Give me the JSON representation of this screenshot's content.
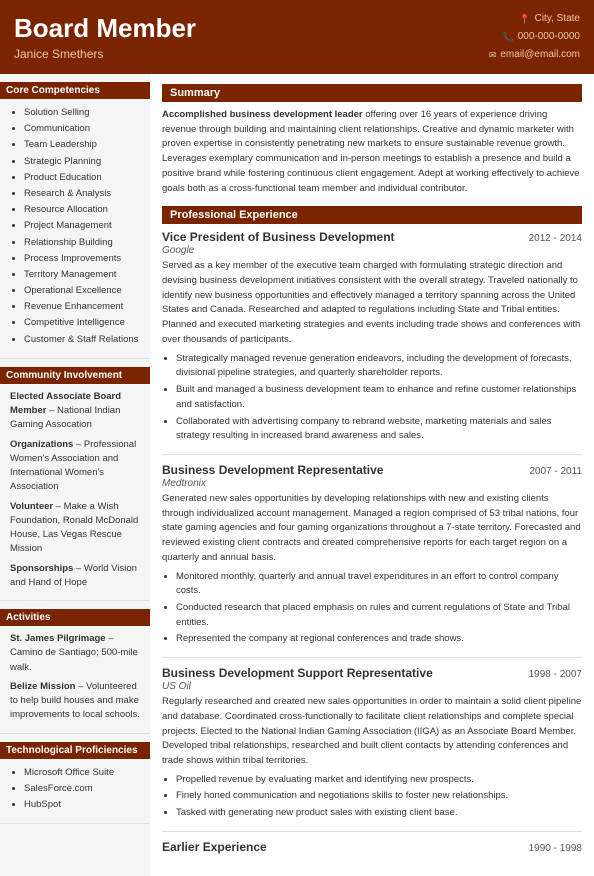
{
  "header": {
    "name": "Board Member",
    "subtitle": "Janice Smethers",
    "contact": {
      "city": "City, State",
      "phone": "000-000-0000",
      "email": "email@email.com"
    }
  },
  "sidebar": {
    "sections": [
      {
        "title": "Core Competencies",
        "items": [
          "Solution Selling",
          "Communication",
          "Team Leadership",
          "Strategic Planning",
          "Product Education",
          "Research & Analysis",
          "Resource Allocation",
          "Project Management",
          "Relationship Building",
          "Process Improvements",
          "Territory Management",
          "Operational Excellence",
          "Revenue Enhancement",
          "Competitive Intelligence",
          "Customer & Staff Relations"
        ]
      },
      {
        "title": "Community Involvement",
        "content": [
          {
            "label": "Elected Associate Board Member",
            "detail": " – National Indian Gaming Assocation"
          },
          {
            "label": "Organizations",
            "detail": " – Professional Women's Association and International Women's Association"
          },
          {
            "label": "Volunteer",
            "detail": " – Make a Wish Foundation, Ronald McDonald House, Las Vegas Rescue Mission"
          },
          {
            "label": "Sponsorships",
            "detail": " – World Vision and Hand of Hope"
          }
        ]
      },
      {
        "title": "Activities",
        "content": [
          {
            "label": "St. James Pilgrimage",
            "detail": " – Camino de Santiago; 500-mile walk."
          },
          {
            "label": "Belize Mission",
            "detail": " – Volunteered to help build houses and make improvements to local schools."
          }
        ]
      },
      {
        "title": "Technological Proficiencies",
        "items": [
          "Microsoft Office Suite",
          "SalesForce.com",
          "HubSpot"
        ]
      }
    ]
  },
  "content": {
    "summary_title": "Summary",
    "summary": "Accomplished business development leader offering over 16 years of experience driving revenue through building and maintaining client relationships. Creative and dynamic marketer with proven expertise in consistently penetrating new markets to ensure sustainable revenue growth. Leverages exemplary communication and in-person meetings to establish a presence and build a positive brand while fostering continuous client engagement. Adept at working effectively to achieve goals both as a cross-functional team member and individual contributor.",
    "experience_title": "Professional Experience",
    "jobs": [
      {
        "title": "Vice President of Business Development",
        "dates": "2012 - 2014",
        "company": "Google",
        "description": "Served as a key member of the executive team charged with formulating strategic direction and devising business development initiatives consistent with the overall strategy. Traveled nationally to identify new business opportunities and effectively managed a territory spanning across the United States and Canada. Researched and adapted to regulations including State and Tribal entities. Planned and executed marketing strategies and events including trade shows and conferences with over thousands of participants.",
        "bullets": [
          "Strategically managed revenue generation endeavors, including the development of forecasts, divisional pipeline strategies, and quarterly shareholder reports.",
          "Built and managed a business development team to enhance and refine customer relationships and satisfaction.",
          "Collaborated with advertising company to rebrand website, marketing materials and sales strategy resulting in increased brand awareness and sales."
        ]
      },
      {
        "title": "Business Development Representative",
        "dates": "2007 - 2011",
        "company": "Medtronix",
        "description": "Generated new sales opportunities by developing relationships with new and existing clients through individualized account management. Managed a region comprised of 53 tribal nations, four state gaming agencies and four gaming organizations throughout a 7-state territory. Forecasted and reviewed existing client contracts and created comprehensive reports for each target region on a quarterly and annual basis.",
        "bullets": [
          "Monitored monthly, quarterly and annual travel expenditures in an effort to control company costs.",
          "Conducted research that placed emphasis on rules and current regulations of State and Tribal entities.",
          "Represented the company at regional conferences and trade shows."
        ]
      },
      {
        "title": "Business Development Support Representative",
        "dates": "1998 - 2007",
        "company": "US Oil",
        "description": "Regularly researched and created new sales opportunities in order to maintain a solid client pipeline and database. Coordinated cross-functionally to facilitate client relationships and complete special projects. Elected to the National Indian Gaming Association (IIGA) as an Associate Board Member. Developed tribal relationships, researched and built client contacts by attending conferences and trade shows within tribal territories.",
        "bullets": [
          "Propelled revenue by evaluating market and identifying new prospects.",
          "Finely honed communication and negotiations skills to foster new relationships.",
          "Tasked with generating new product sales with existing client base."
        ]
      },
      {
        "title": "Earlier Experience",
        "dates": "1990 - 1998",
        "company": "",
        "description": "",
        "bullets": []
      }
    ]
  }
}
